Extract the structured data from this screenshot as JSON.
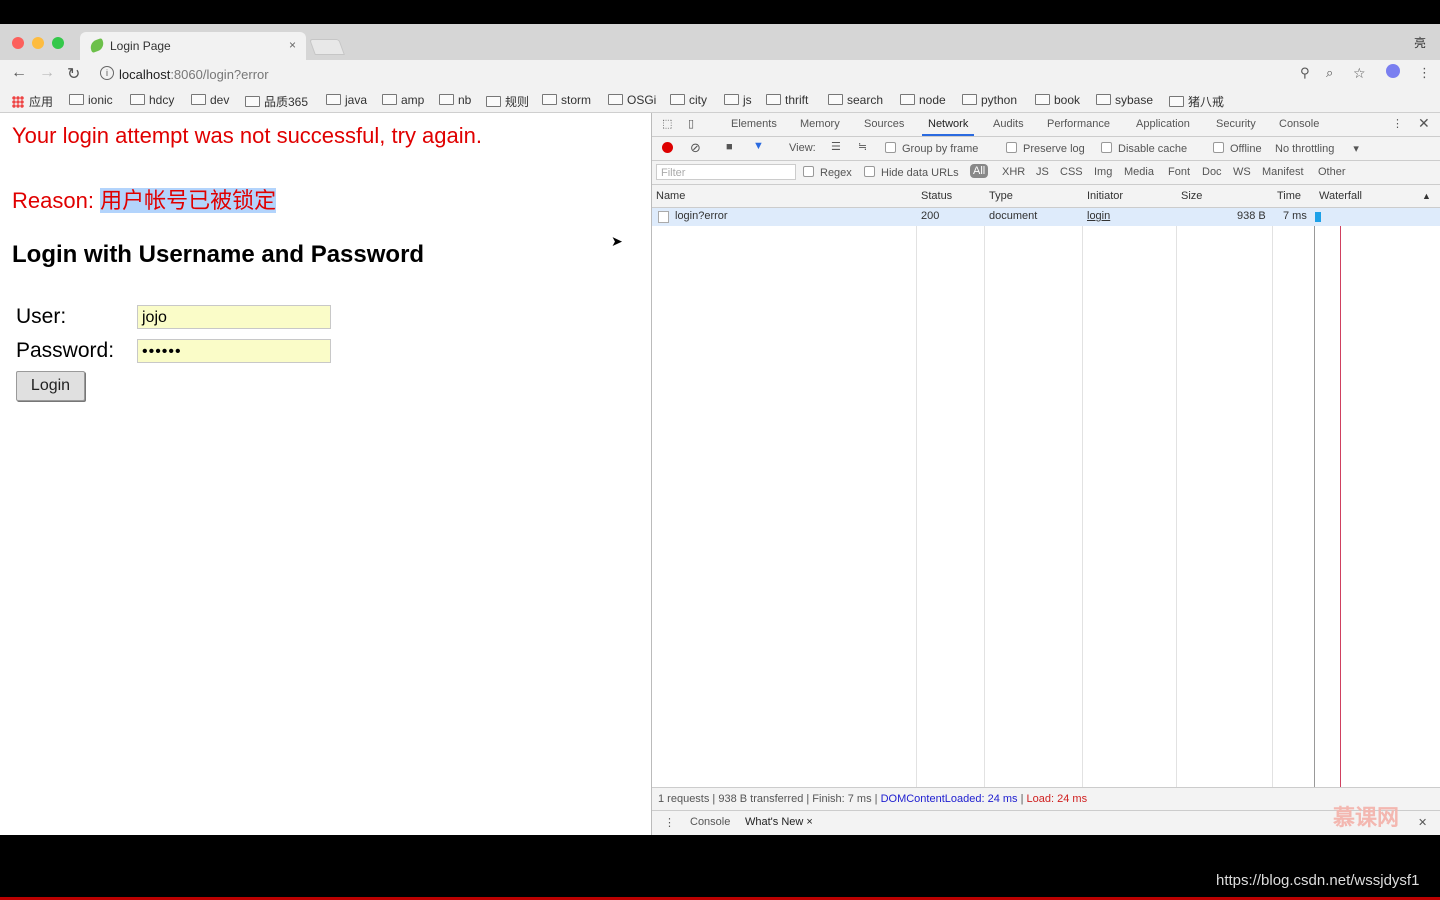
{
  "browser": {
    "tab_title": "Login Page",
    "tab_close": "×",
    "profile_label": "亮",
    "url_host": "localhost",
    "url_rest": ":8060/login?error",
    "bookmarks": [
      {
        "label": "应用",
        "icon": "apps-grid-icon"
      },
      {
        "label": "ionic"
      },
      {
        "label": "hdcy"
      },
      {
        "label": "dev"
      },
      {
        "label": "品质365"
      },
      {
        "label": "java"
      },
      {
        "label": "amp"
      },
      {
        "label": "nb"
      },
      {
        "label": "规则"
      },
      {
        "label": "storm"
      },
      {
        "label": "OSGi"
      },
      {
        "label": "city"
      },
      {
        "label": "js"
      },
      {
        "label": "thrift"
      },
      {
        "label": "search"
      },
      {
        "label": "node"
      },
      {
        "label": "python"
      },
      {
        "label": "book"
      },
      {
        "label": "sybase"
      },
      {
        "label": "猪八戒"
      }
    ]
  },
  "page": {
    "error_message": "Your login attempt was not successful, try again.",
    "reason_label": "Reason:",
    "reason_value": "用户帐号已被锁定",
    "heading": "Login with Username and Password",
    "user_label": "User:",
    "user_value": "jojo",
    "password_label": "Password:",
    "password_value": "••••••",
    "login_button": "Login"
  },
  "devtools": {
    "tabs": [
      "Elements",
      "Memory",
      "Sources",
      "Network",
      "Audits",
      "Performance",
      "Application",
      "Security",
      "Console"
    ],
    "active_tab": "Network",
    "controls": {
      "view_label": "View:",
      "group_by_frame": "Group by frame",
      "preserve_log": "Preserve log",
      "disable_cache": "Disable cache",
      "offline": "Offline",
      "throttling": "No throttling"
    },
    "filter": {
      "placeholder": "Filter",
      "regex": "Regex",
      "hide_data_urls": "Hide data URLs",
      "all": "All",
      "types": [
        "XHR",
        "JS",
        "CSS",
        "Img",
        "Media",
        "Font",
        "Doc",
        "WS",
        "Manifest",
        "Other"
      ]
    },
    "columns": [
      "Name",
      "Status",
      "Type",
      "Initiator",
      "Size",
      "Time",
      "Waterfall"
    ],
    "rows": [
      {
        "name": "login?error",
        "status": "200",
        "type": "document",
        "initiator": "login",
        "size": "938 B",
        "time": "7 ms"
      }
    ],
    "status_bar": {
      "summary": "1 requests | 938 B transferred | Finish: 7 ms |",
      "dom_loaded": "DOMContentLoaded: 24 ms",
      "separator": "|",
      "load": "Load: 24 ms"
    },
    "drawer_tabs": [
      "Console",
      "What's New"
    ],
    "drawer_close": "×"
  },
  "overlay": {
    "watermark": "慕课网",
    "credit": "https://blog.csdn.net/wssjdysf1"
  },
  "colors": {
    "error_red": "#e00000",
    "dom_loaded_blue": "#2020d0",
    "load_red": "#d02020",
    "selection_blue": "#b3d4fc",
    "autofill_yellow": "#fafcc8"
  }
}
